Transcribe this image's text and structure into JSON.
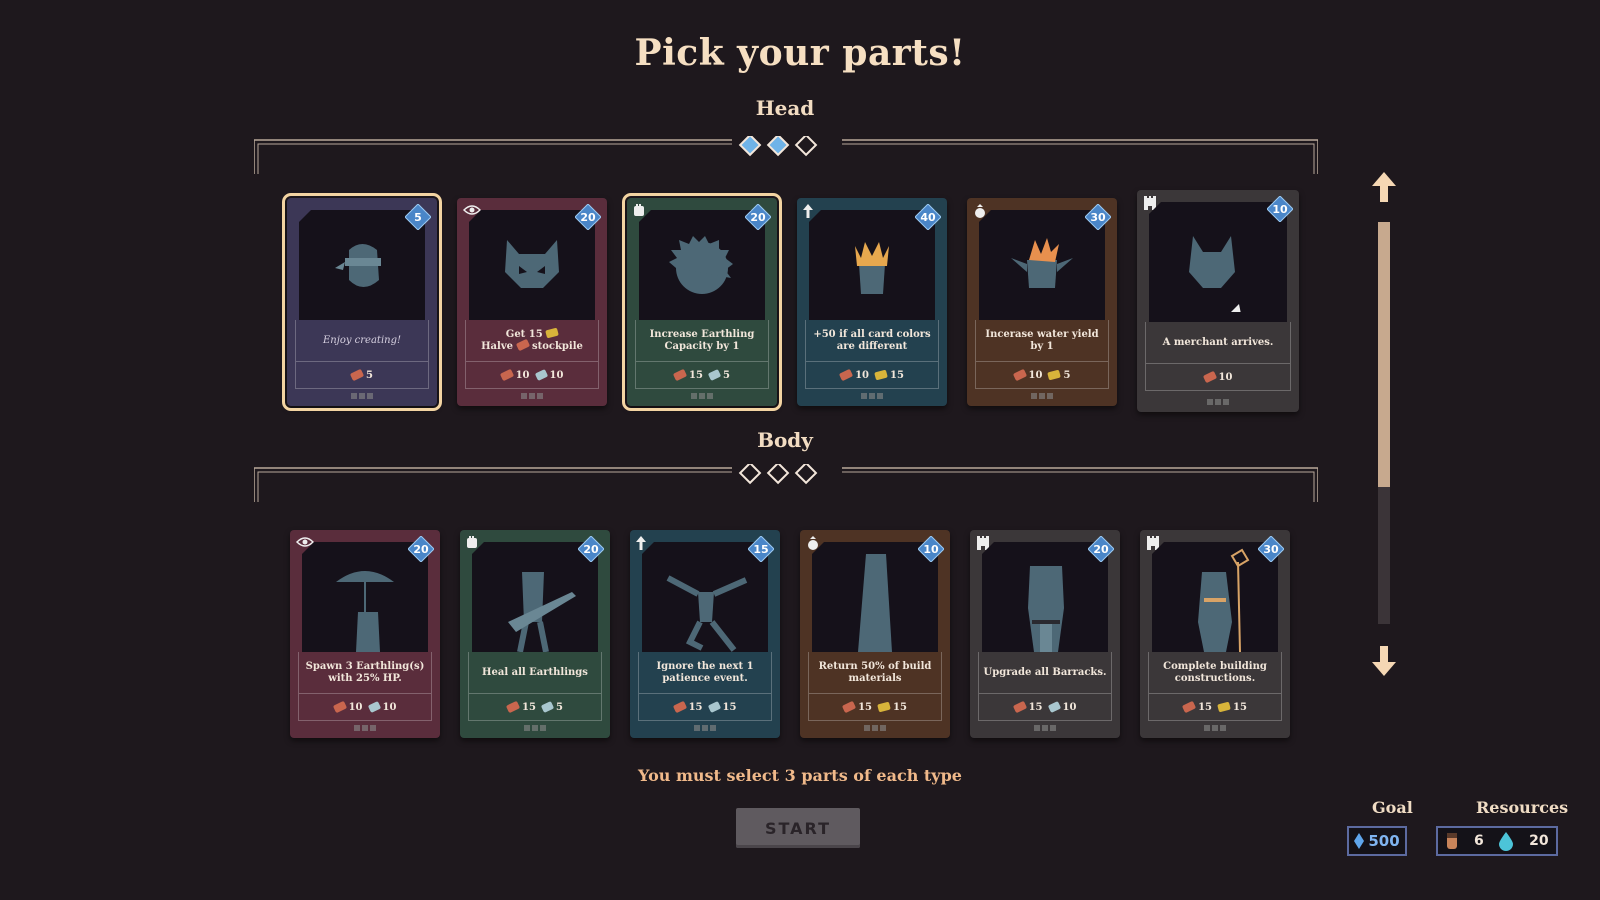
{
  "title": "Pick your parts!",
  "head_section": {
    "label": "Head",
    "selected_count": 2,
    "total": 3
  },
  "body_section": {
    "label": "Body",
    "selected_count": 0,
    "total": 3
  },
  "head_cards": [
    {
      "type_icon": "none",
      "badge": "5",
      "desc": "Enjoy creating!",
      "italic": true,
      "color": "#3c3756",
      "art": "blindfold-head",
      "costs": [
        {
          "res": "wood",
          "n": "5"
        }
      ],
      "selected": true
    },
    {
      "type_icon": "eye-icon",
      "badge": "20",
      "desc": "Get 15 [gold] Halve [wood] stockpile",
      "desc_lines": [
        "Get 15",
        "Halve",
        "stockpile"
      ],
      "color": "#5a2d3c",
      "art": "cat-skull",
      "costs": [
        {
          "res": "wood",
          "n": "10"
        },
        {
          "res": "stone",
          "n": "10"
        }
      ],
      "selected": false
    },
    {
      "type_icon": "fist-icon",
      "badge": "20",
      "desc": "Increase Earthling Capacity by 1",
      "color": "#2f4a3e",
      "art": "hairy-head",
      "costs": [
        {
          "res": "wood",
          "n": "15"
        },
        {
          "res": "stone",
          "n": "5"
        }
      ],
      "selected": true
    },
    {
      "type_icon": "arrow-up-icon",
      "badge": "40",
      "desc": "+50 if all card colors are different",
      "color": "#23414f",
      "art": "crowned-head",
      "costs": [
        {
          "res": "wood",
          "n": "10"
        },
        {
          "res": "gold",
          "n": "15"
        }
      ],
      "selected": false
    },
    {
      "type_icon": "bag-icon",
      "badge": "30",
      "desc": "Incerase water yield by 1",
      "color": "#4e3324",
      "art": "goblin-head",
      "costs": [
        {
          "res": "wood",
          "n": "10"
        },
        {
          "res": "gold",
          "n": "5"
        }
      ],
      "selected": false
    },
    {
      "type_icon": "tower-icon",
      "badge": "10",
      "desc": "A merchant arrives.",
      "color": "#3b3739",
      "art": "fox-head",
      "costs": [
        {
          "res": "wood",
          "n": "10"
        }
      ],
      "selected": false
    }
  ],
  "body_cards": [
    {
      "type_icon": "eye-icon",
      "badge": "20",
      "desc": "Spawn 3 Earthling(s) with 25% HP.",
      "color": "#5a2d3c",
      "art": "umbrella-body",
      "costs": [
        {
          "res": "wood",
          "n": "10"
        },
        {
          "res": "stone",
          "n": "10"
        }
      ]
    },
    {
      "type_icon": "fist-icon",
      "badge": "20",
      "desc": "Heal all Earthlings",
      "color": "#2f4a3e",
      "art": "guitar-body",
      "costs": [
        {
          "res": "wood",
          "n": "15"
        },
        {
          "res": "stone",
          "n": "5"
        }
      ]
    },
    {
      "type_icon": "arrow-up-icon",
      "badge": "15",
      "desc": "Ignore the next 1 patience event.",
      "color": "#23414f",
      "art": "dancer-body",
      "costs": [
        {
          "res": "wood",
          "n": "15"
        },
        {
          "res": "stone",
          "n": "15"
        }
      ]
    },
    {
      "type_icon": "bag-icon",
      "badge": "10",
      "desc": "Return 50% of build materials",
      "color": "#4e3324",
      "art": "monolith-body",
      "costs": [
        {
          "res": "wood",
          "n": "15"
        },
        {
          "res": "gold",
          "n": "15"
        }
      ]
    },
    {
      "type_icon": "tower-icon",
      "badge": "20",
      "desc": "Upgrade all Barracks.",
      "color": "#3b3739",
      "art": "armor-body",
      "costs": [
        {
          "res": "wood",
          "n": "15"
        },
        {
          "res": "stone",
          "n": "10"
        }
      ]
    },
    {
      "type_icon": "tower-icon",
      "badge": "30",
      "desc": "Complete building constructions.",
      "color": "#3b3739",
      "art": "wizard-body",
      "costs": [
        {
          "res": "wood",
          "n": "15"
        },
        {
          "res": "gold",
          "n": "15"
        }
      ]
    }
  ],
  "hint": "You must select 3 parts of each type",
  "start_label": "START",
  "goal": {
    "label": "Goal",
    "value": "500"
  },
  "resources": {
    "label": "Resources",
    "earthlings": "6",
    "water": "20"
  },
  "scroll_position": 0.66,
  "colors": {
    "badge": "#4a86c8",
    "selected_outline": "#f3d4a2"
  }
}
